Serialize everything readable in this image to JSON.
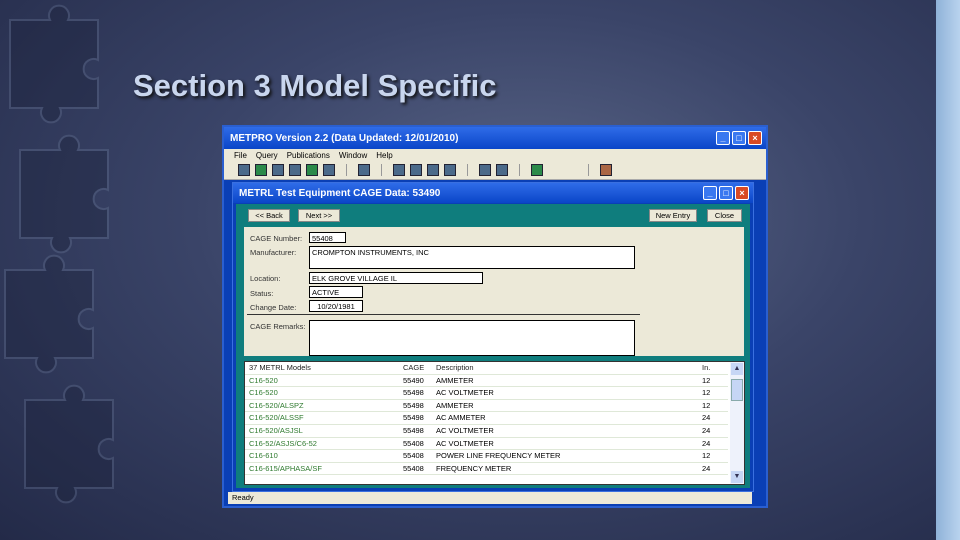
{
  "slide": {
    "title": "Section 3 Model Specific"
  },
  "app": {
    "title": "METPRO   Version 2.2    (Data Updated: 12/01/2010)",
    "menu": [
      "File",
      "Query",
      "Publications",
      "Window",
      "Help"
    ],
    "status": "Ready"
  },
  "child": {
    "title": "METRL Test Equipment CAGE Data: 53490",
    "buttons": {
      "back": "<< Back",
      "next": "Next >>",
      "new_entry": "New Entry",
      "close": "Close"
    },
    "form": {
      "cage_label": "CAGE Number:",
      "cage": "55408",
      "mfr_label": "Manufacturer:",
      "mfr": "CROMPTON INSTRUMENTS, INC",
      "loc_label": "Location:",
      "loc": "ELK GROVE VILLAGE IL",
      "status_label": "Status:",
      "status": "ACTIVE",
      "date_label": "Change Date:",
      "date": "10/20/1981",
      "remarks_label": "CAGE Remarks:",
      "remarks": ""
    },
    "list": {
      "headers": [
        "37 METRL Models",
        "CAGE",
        "Description",
        "In."
      ],
      "rows": [
        [
          "C16-520",
          "55490",
          "AMMETER",
          "12"
        ],
        [
          "C16-520",
          "55498",
          "AC VOLTMETER",
          "12"
        ],
        [
          "C16-520/ALSPZ",
          "55498",
          "AMMETER",
          "12"
        ],
        [
          "C16-520/ALSSF",
          "55498",
          "AC AMMETER",
          "24"
        ],
        [
          "C16-520/ASJSL",
          "55498",
          "AC VOLTMETER",
          "24"
        ],
        [
          "C16-52/ASJS/C6-52",
          "55408",
          "AC VOLTMETER",
          "24"
        ],
        [
          "C16-610",
          "55408",
          "POWER LINE FREQUENCY METER",
          "12"
        ],
        [
          "C16-615/APHASA/SF",
          "55408",
          "FREQUENCY METER",
          "24"
        ]
      ]
    }
  }
}
